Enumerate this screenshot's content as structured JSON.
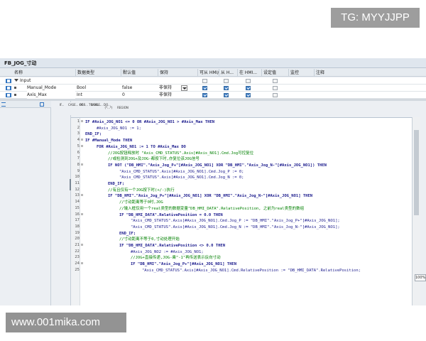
{
  "watermarks": {
    "top_right": "TG: MYYJJPP",
    "bottom_left": "www.001mika.com"
  },
  "block": {
    "title": "FB_JOG_寸动"
  },
  "interface": {
    "columns": [
      "名称",
      "数据类型",
      "默认值",
      "保持",
      "可从 HMI/...",
      "从 H...",
      "在 HMI...",
      "设定值",
      "监控",
      "注释"
    ],
    "rows": [
      {
        "name": "Input",
        "type": "",
        "default": "",
        "retain": "",
        "c1": false,
        "c2": false,
        "c3": false,
        "setpoint": false,
        "show_checks": false,
        "level": 0
      },
      {
        "name": "Manual_Mode",
        "type": "Bool",
        "default": "false",
        "retain": "非保持",
        "c1": true,
        "c2": true,
        "c3": true,
        "setpoint": false,
        "show_checks": true,
        "level": 1
      },
      {
        "name": "Axis_Max",
        "type": "Int",
        "default": "0",
        "retain": "非保持",
        "c1": true,
        "c2": true,
        "c3": true,
        "setpoint": false,
        "show_checks": true,
        "level": 1
      }
    ]
  },
  "toolbar": {
    "items": [
      "IF...",
      "CASE... OF...",
      "FOR... TO DO...",
      "WHILE... DO...",
      "(*...*)",
      "REGION"
    ]
  },
  "zoom": "100%",
  "code_lines": [
    {
      "n": "1",
      "fold": "⊟",
      "indent": 0,
      "kind": "kw",
      "text": "IF #Axis_JOG_NO1 <= 0 OR #Axis_JOG_NO1 > #Axis_Max THEN"
    },
    {
      "n": "2",
      "fold": "",
      "indent": 1,
      "kind": "",
      "text": "#Axis_JOG_NO1 := 1;"
    },
    {
      "n": "3",
      "fold": "",
      "indent": 0,
      "kind": "kw",
      "text": "END_IF;"
    },
    {
      "n": "4",
      "fold": "⊟",
      "indent": 0,
      "kind": "kw",
      "text": "IF #Manual_Mode THEN"
    },
    {
      "n": "5",
      "fold": "⊟",
      "indent": 1,
      "kind": "kw",
      "text": "FOR #Axis_JOG_NO1 := 1 TO #Axis_Max DO"
    },
    {
      "n": "6",
      "fold": "",
      "indent": 2,
      "kind": "cm",
      "text": "//JOG按钮释放时 \"Axis_CMD_STATUS\".Axis[#Axis_NO1].Cmd.Jog可控复位"
    },
    {
      "n": "7",
      "fold": "",
      "indent": 2,
      "kind": "cm",
      "text": "//或检测到JOG+及JOG-都按下时,亦复位该JOG信号"
    },
    {
      "n": "8",
      "fold": "⊟",
      "indent": 2,
      "kind": "kw",
      "text": "IF NOT (\"DB_HMI\".\"Axis_Jog_P+\"[#Axis_JOG_NO1] XOR \"DB_HMI\".\"Axis_Jog_N-\"[#Axis_JOG_NO1]) THEN"
    },
    {
      "n": "9",
      "fold": "",
      "indent": 3,
      "kind": "",
      "text": "\"Axis_CMD_STATUS\".Axis[#Axis_JOG_NO1].Cmd.Jog_P := 0;"
    },
    {
      "n": "10",
      "fold": "",
      "indent": 3,
      "kind": "",
      "text": "\"Axis_CMD_STATUS\".Axis[#Axis_JOG_NO1].Cmd.Jog_N := 0;"
    },
    {
      "n": "11",
      "fold": "",
      "indent": 2,
      "kind": "kw",
      "text": "END_IF;"
    },
    {
      "n": "12",
      "fold": "",
      "indent": 2,
      "kind": "cm",
      "text": "//有且仅有一个JOG按下时(+/-)执行"
    },
    {
      "n": "13",
      "fold": "⊟",
      "indent": 2,
      "kind": "kw",
      "text": "IF \"DB_HMI\".\"Axis_Jog_P+\"[#Axis_JOG_NO1] XOR \"DB_HMI\".\"Axis_Jog_N-\"[#Axis_JOG_NO1] THEN"
    },
    {
      "n": "14",
      "fold": "",
      "indent": 3,
      "kind": "cm",
      "text": "//寸动距离等于0时,JOG"
    },
    {
      "n": "15",
      "fold": "",
      "indent": 3,
      "kind": "cm",
      "text": "//输入框仅用一个real类型的数据变量\"DB_HMI_DATA\".RelativePosition, 之前为real类型的数组"
    },
    {
      "n": "16",
      "fold": "⊟",
      "indent": 3,
      "kind": "kw",
      "text": "IF \"DB_HMI_DATA\".RelativePosition = 0.0 THEN"
    },
    {
      "n": "17",
      "fold": "",
      "indent": 4,
      "kind": "",
      "text": "\"Axis_CMD_STATUS\".Axis[#Axis_JOG_NO1].Cmd.Jog_P := \"DB_HMI\".\"Axis_Jog_P+\"[#Axis_JOG_NO1];"
    },
    {
      "n": "18",
      "fold": "",
      "indent": 4,
      "kind": "",
      "text": "\"Axis_CMD_STATUS\".Axis[#Axis_JOG_NO1].Cmd.Jog_N := \"DB_HMI\".\"Axis_Jog_N-\"[#Axis_JOG_NO1];"
    },
    {
      "n": "19",
      "fold": "",
      "indent": 3,
      "kind": "kw",
      "text": "END_IF;"
    },
    {
      "n": "20",
      "fold": "",
      "indent": 3,
      "kind": "cm",
      "text": "//寸动距离不等于0,寸动处理开始"
    },
    {
      "n": "21",
      "fold": "⊟",
      "indent": 3,
      "kind": "kw",
      "text": "IF \"DB_HMI_DATA\".RelativePosition <> 0.0 THEN"
    },
    {
      "n": "22",
      "fold": "",
      "indent": 4,
      "kind": "",
      "text": "#Axis_JOG_NO2 := #Axis_JOG_NO1;"
    },
    {
      "n": "23",
      "fold": "",
      "indent": 4,
      "kind": "cm",
      "text": "//JOG+直接传递,JOG-乘\"-1\"再传送表示反向寸动"
    },
    {
      "n": "24",
      "fold": "⊟",
      "indent": 4,
      "kind": "kw",
      "text": "IF \"DB_HMI\".\"Axis_Jog_P+\"[#Axis_JOG_NO1] THEN"
    },
    {
      "n": "25",
      "fold": "",
      "indent": 5,
      "kind": "",
      "text": "\"Axis_CMD_STATUS\".Axis[#Axis_JOG_NO1].Cmd.RelativePosition := \"DB_HMI_DATA\".RelativePosition;"
    }
  ]
}
